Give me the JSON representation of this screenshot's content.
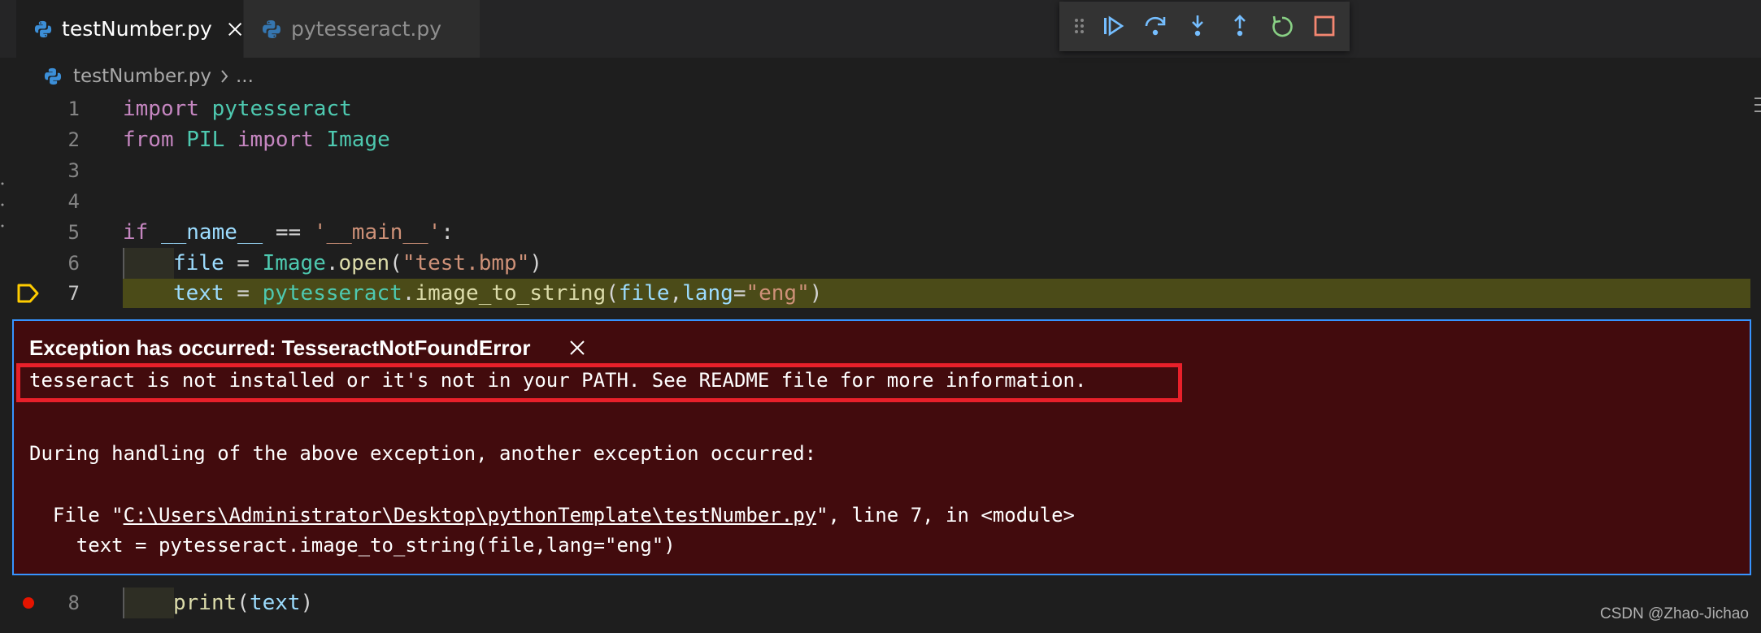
{
  "tabs": [
    {
      "label": "testNumber.py",
      "active": true
    },
    {
      "label": "pytesseract.py",
      "active": false
    }
  ],
  "breadcrumb": {
    "file": "testNumber.py",
    "rest": "..."
  },
  "debug_toolbar": {
    "buttons": [
      "drag-handle-icon",
      "continue-icon",
      "step-over-icon",
      "step-into-icon",
      "step-out-icon",
      "restart-icon",
      "stop-icon"
    ],
    "colors": {
      "blue": "#75beff",
      "green": "#89d185",
      "red": "#f48771"
    }
  },
  "code": {
    "lines": [
      {
        "n": "1",
        "tokens": [
          "import",
          " ",
          "pytesseract"
        ]
      },
      {
        "n": "2",
        "tokens": [
          "from",
          " ",
          "PIL",
          " ",
          "import",
          " ",
          "Image"
        ]
      },
      {
        "n": "3",
        "tokens": []
      },
      {
        "n": "4",
        "tokens": []
      },
      {
        "n": "5",
        "tokens": [
          "if",
          " ",
          "__name__",
          " == ",
          "'__main__'",
          ":"
        ]
      },
      {
        "n": "6",
        "tokens": [
          "file",
          " = ",
          "Image",
          ".",
          "open",
          "(",
          "\"test.bmp\"",
          ")"
        ]
      },
      {
        "n": "7",
        "tokens": [
          "text",
          " = ",
          "pytesseract",
          ".",
          "image_to_string",
          "(",
          "file",
          ",",
          "lang",
          "=",
          "\"eng\"",
          ")"
        ]
      },
      {
        "n": "8",
        "tokens": [
          "print",
          "(",
          "text",
          ")"
        ]
      }
    ],
    "current_line": 7,
    "breakpoint_line": 8
  },
  "exception": {
    "title": "Exception has occurred: TesseractNotFoundError",
    "message": "tesseract is not installed or it's not in your PATH. See README file for more information.",
    "during": "During handling of the above exception, another exception occurred:",
    "file_prefix": "  File \"",
    "file_path": "C:\\Users\\Administrator\\Desktop\\pythonTemplate\\testNumber.py",
    "file_suffix": "\", line 7, in <module>",
    "code_line": "    text = pytesseract.image_to_string(file,lang=\"eng\")"
  },
  "watermark": "CSDN @Zhao-Jichao",
  "colors": {
    "editor_bg": "#1e1e1e",
    "exception_bg": "#420b0d",
    "exception_border": "#3794ff",
    "highlight_red": "#e8202a",
    "current_line_bg": "#4b4b18"
  }
}
